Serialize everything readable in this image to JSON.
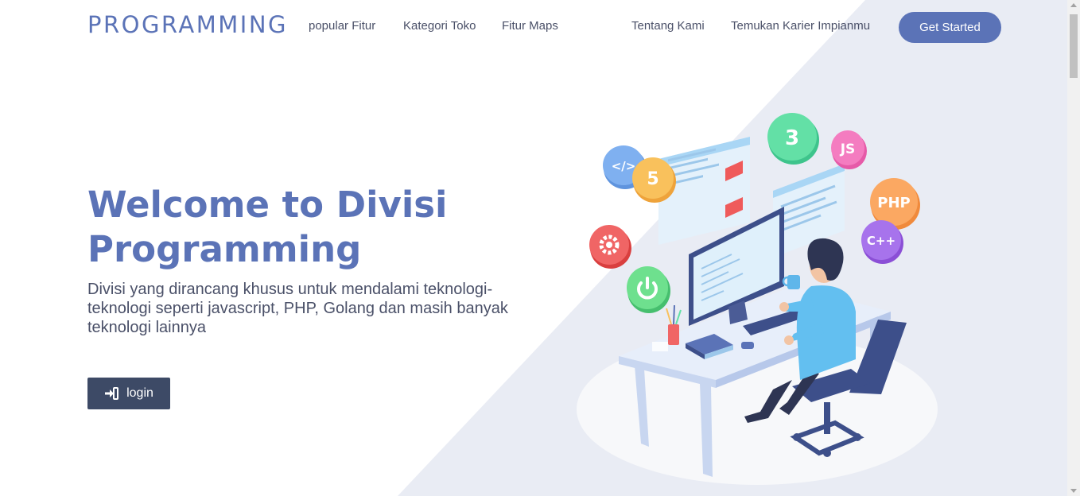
{
  "brand": "PROGRAMMING",
  "nav": {
    "links": [
      "popular Fitur",
      "Kategori Toko",
      "Fitur Maps",
      "Tentang Kami",
      "Temukan Karier Impianmu"
    ],
    "cta_label": "Get Started"
  },
  "hero": {
    "title": "Welcome to Divisi Programming",
    "subtitle": "Divisi yang dirancang khusus untuk mendalami teknologi-teknologi seperti javascript, PHP, Golang dan masih banyak teknologi lainnya",
    "login_label": "login"
  },
  "illustration": {
    "badges": [
      "</>",
      "5",
      "3",
      "JS",
      "PHP",
      "C++"
    ]
  },
  "colors": {
    "accent": "#5b73b7",
    "text": "#4a5068",
    "button_dark": "#3d4a66",
    "background_shape": "#e9ecf4"
  }
}
